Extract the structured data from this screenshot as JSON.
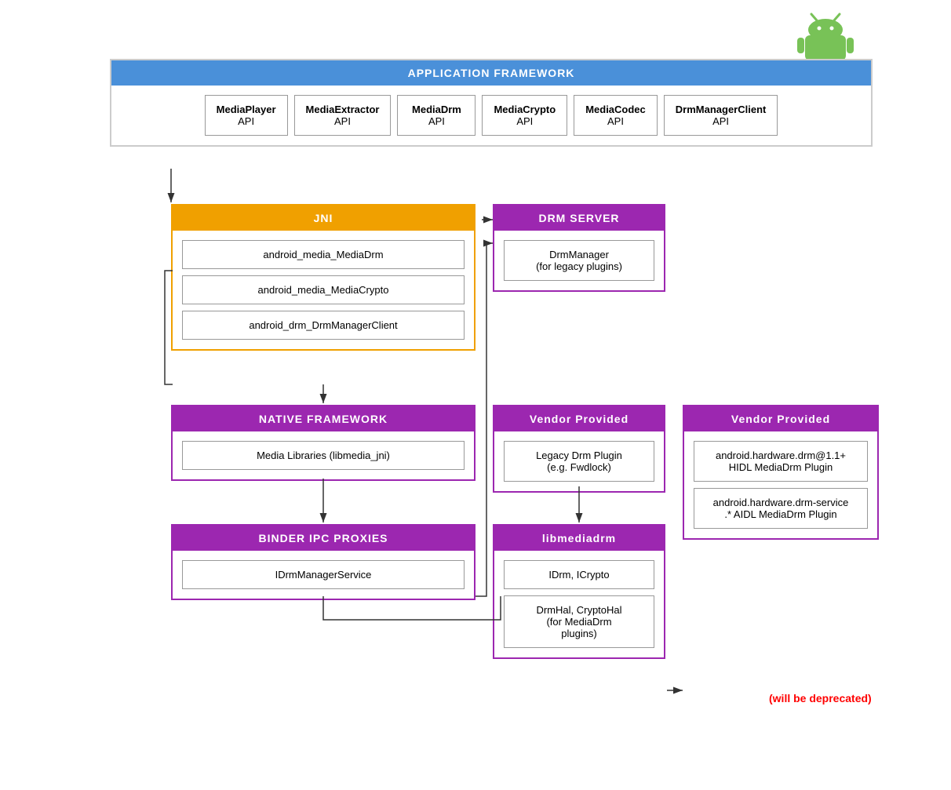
{
  "androidLogo": {
    "color": "#78C257",
    "label": "Android"
  },
  "appFramework": {
    "header": "APPLICATION FRAMEWORK",
    "items": [
      {
        "name": "MediaPlayer",
        "sub": "API"
      },
      {
        "name": "MediaExtractor",
        "sub": "API"
      },
      {
        "name": "MediaDrm",
        "sub": "API"
      },
      {
        "name": "MediaCrypto",
        "sub": "API"
      },
      {
        "name": "MediaCodec",
        "sub": "API"
      },
      {
        "name": "DrmManagerClient",
        "sub": "API"
      }
    ]
  },
  "jni": {
    "header": "JNI",
    "items": [
      "android_media_MediaDrm",
      "android_media_MediaCrypto",
      "android_drm_DrmManagerClient"
    ]
  },
  "nativeFramework": {
    "header": "NATIVE FRAMEWORK",
    "items": [
      "Media Libraries (libmedia_jni)"
    ]
  },
  "binderIpc": {
    "header": "BINDER IPC PROXIES",
    "items": [
      "IDrmManagerService"
    ]
  },
  "drmServer": {
    "header": "DRM SERVER",
    "items": [
      "DrmManager\n(for legacy plugins)"
    ]
  },
  "vendorLeft": {
    "header": "Vendor Provided",
    "items": [
      "Legacy Drm Plugin\n(e.g. Fwdlock)"
    ]
  },
  "libmediadrm": {
    "header": "libmediadrm",
    "items": [
      "IDrm, ICrypto",
      "DrmHal, CryptoHal\n(for MediaDrm\nplugins)"
    ]
  },
  "vendorRight": {
    "header": "Vendor Provided",
    "items": [
      "android.hardware.drm@1.1+\nHIDL MediaDrm Plugin",
      "android.hardware.drm-service\n.* AIDL MediaDrm Plugin"
    ]
  },
  "deprecated": "(will be deprecated)"
}
